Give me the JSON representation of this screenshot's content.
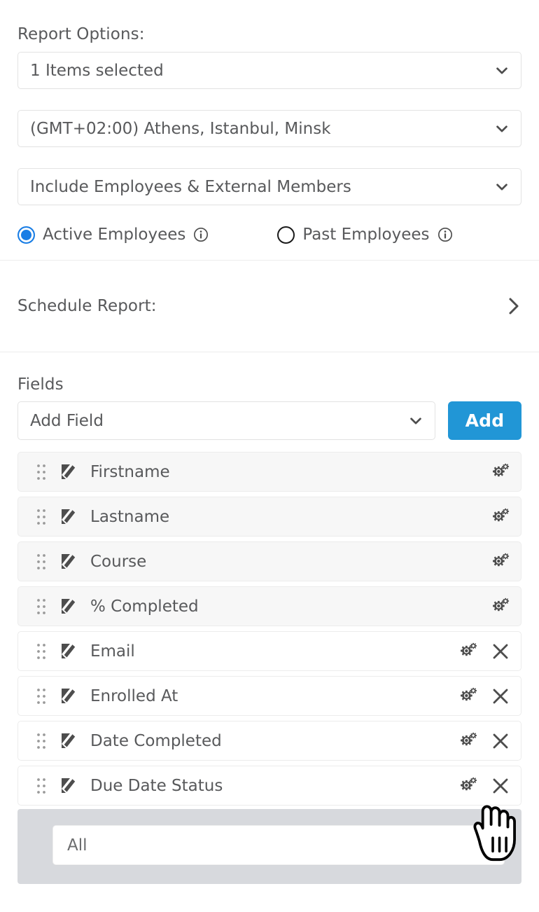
{
  "report_options": {
    "heading": "Report Options:",
    "items_select": {
      "value": "1 Items selected",
      "icon": "chevron-down-icon"
    },
    "timezone_select": {
      "value": "(GMT+02:00) Athens, Istanbul, Minsk",
      "icon": "chevron-down-icon"
    },
    "membership_select": {
      "value": "Include Employees & External Members",
      "icon": "chevron-down-icon"
    },
    "employee_status": {
      "options": [
        {
          "label": "Active Employees",
          "selected": true,
          "info_icon": "info-icon"
        },
        {
          "label": "Past Employees",
          "selected": false,
          "info_icon": "info-icon"
        }
      ]
    }
  },
  "schedule_report": {
    "heading": "Schedule Report:",
    "icon": "chevron-right-icon"
  },
  "fields": {
    "heading": "Fields",
    "add_field_select": {
      "value": "Add Field",
      "icon": "chevron-down-icon"
    },
    "add_button_label": "Add",
    "rows": [
      {
        "name": "Firstname",
        "shaded": true,
        "has_gear": true,
        "has_close": false
      },
      {
        "name": "Lastname",
        "shaded": true,
        "has_gear": true,
        "has_close": false
      },
      {
        "name": "Course",
        "shaded": true,
        "has_gear": true,
        "has_close": false
      },
      {
        "name": "% Completed",
        "shaded": true,
        "has_gear": true,
        "has_close": false
      },
      {
        "name": "Email",
        "shaded": false,
        "has_gear": true,
        "has_close": true
      },
      {
        "name": "Enrolled At",
        "shaded": false,
        "has_gear": true,
        "has_close": true
      },
      {
        "name": "Date Completed",
        "shaded": false,
        "has_gear": true,
        "has_close": true
      },
      {
        "name": "Due Date Status",
        "shaded": false,
        "has_gear": true,
        "has_close": true
      }
    ],
    "expanded_panel": {
      "parent_field": "Due Date Status",
      "filter_select": {
        "value": "All",
        "icon": "chevron-down-icon"
      }
    }
  },
  "colors": {
    "accent_blue": "#2196d6",
    "radio_blue": "#1a7ee5",
    "text": "#58595b",
    "row_shaded": "#f7f7f7",
    "panel_gray": "#d7d9dd",
    "border": "#ececec"
  },
  "cursor": {
    "icon": "pointing-hand-cursor"
  }
}
